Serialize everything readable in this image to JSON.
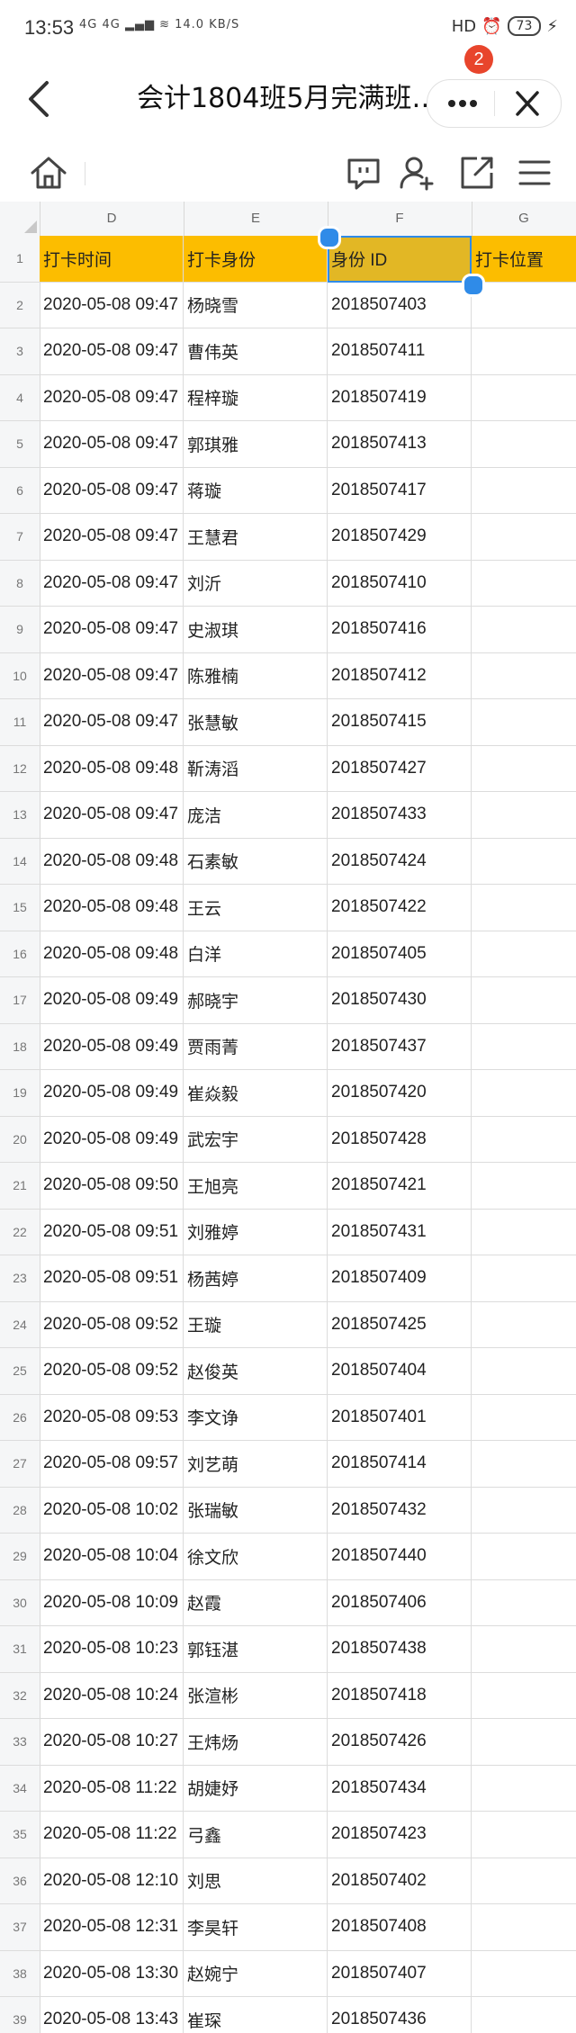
{
  "status_bar": {
    "time": "13:53",
    "left_icons": "4G 4G ▂▄▆ ≋ 14.0 KB/S",
    "hd": "HD",
    "battery": "73"
  },
  "title_bar": {
    "title": "会计1804班5月完满班…",
    "badge_count": "2"
  },
  "sheet": {
    "corner": "",
    "columns": [
      "D",
      "E",
      "F",
      "G"
    ],
    "header_row": {
      "num": "1",
      "d": "打卡时间",
      "e": "打卡身份",
      "f": "身份 ID",
      "g": "打卡位置"
    },
    "rows": [
      {
        "num": "2",
        "time": "2020-05-08 09:47",
        "name": "杨晓雪",
        "id": "2018507403"
      },
      {
        "num": "3",
        "time": "2020-05-08 09:47",
        "name": "曹伟英",
        "id": "2018507411"
      },
      {
        "num": "4",
        "time": "2020-05-08 09:47",
        "name": "程梓璇",
        "id": "2018507419"
      },
      {
        "num": "5",
        "time": "2020-05-08 09:47",
        "name": "郭琪雅",
        "id": "2018507413"
      },
      {
        "num": "6",
        "time": "2020-05-08 09:47",
        "name": "蒋璇",
        "id": "2018507417"
      },
      {
        "num": "7",
        "time": "2020-05-08 09:47",
        "name": "王慧君",
        "id": "2018507429"
      },
      {
        "num": "8",
        "time": "2020-05-08 09:47",
        "name": "刘沂",
        "id": "2018507410"
      },
      {
        "num": "9",
        "time": "2020-05-08 09:47",
        "name": "史淑琪",
        "id": "2018507416"
      },
      {
        "num": "10",
        "time": "2020-05-08 09:47",
        "name": "陈雅楠",
        "id": "2018507412"
      },
      {
        "num": "11",
        "time": "2020-05-08 09:47",
        "name": "张慧敏",
        "id": "2018507415"
      },
      {
        "num": "12",
        "time": "2020-05-08 09:48",
        "name": "靳涛滔",
        "id": "2018507427"
      },
      {
        "num": "13",
        "time": "2020-05-08 09:47",
        "name": "庞洁",
        "id": "2018507433"
      },
      {
        "num": "14",
        "time": "2020-05-08 09:48",
        "name": "石素敏",
        "id": "2018507424"
      },
      {
        "num": "15",
        "time": "2020-05-08 09:48",
        "name": "王云",
        "id": "2018507422"
      },
      {
        "num": "16",
        "time": "2020-05-08 09:48",
        "name": "白洋",
        "id": "2018507405"
      },
      {
        "num": "17",
        "time": "2020-05-08 09:49",
        "name": "郝晓宇",
        "id": "2018507430"
      },
      {
        "num": "18",
        "time": "2020-05-08 09:49",
        "name": "贾雨菁",
        "id": "2018507437"
      },
      {
        "num": "19",
        "time": "2020-05-08 09:49",
        "name": "崔焱毅",
        "id": "2018507420"
      },
      {
        "num": "20",
        "time": "2020-05-08 09:49",
        "name": "武宏宇",
        "id": "2018507428"
      },
      {
        "num": "21",
        "time": "2020-05-08 09:50",
        "name": "王旭亮",
        "id": "2018507421"
      },
      {
        "num": "22",
        "time": "2020-05-08 09:51",
        "name": "刘雅婷",
        "id": "2018507431"
      },
      {
        "num": "23",
        "time": "2020-05-08 09:51",
        "name": "杨茜婷",
        "id": "2018507409"
      },
      {
        "num": "24",
        "time": "2020-05-08 09:52",
        "name": "王璇",
        "id": "2018507425"
      },
      {
        "num": "25",
        "time": "2020-05-08 09:52",
        "name": "赵俊英",
        "id": "2018507404"
      },
      {
        "num": "26",
        "time": "2020-05-08 09:53",
        "name": "李文诤",
        "id": "2018507401"
      },
      {
        "num": "27",
        "time": "2020-05-08 09:57",
        "name": "刘艺萌",
        "id": "2018507414"
      },
      {
        "num": "28",
        "time": "2020-05-08 10:02",
        "name": "张瑞敏",
        "id": "2018507432"
      },
      {
        "num": "29",
        "time": "2020-05-08 10:04",
        "name": "徐文欣",
        "id": "2018507440"
      },
      {
        "num": "30",
        "time": "2020-05-08 10:09",
        "name": "赵霞",
        "id": "2018507406"
      },
      {
        "num": "31",
        "time": "2020-05-08 10:23",
        "name": "郭钰湛",
        "id": "2018507438"
      },
      {
        "num": "32",
        "time": "2020-05-08 10:24",
        "name": "张渲彬",
        "id": "2018507418"
      },
      {
        "num": "33",
        "time": "2020-05-08 10:27",
        "name": "王炜炀",
        "id": "2018507426"
      },
      {
        "num": "34",
        "time": "2020-05-08 11:22",
        "name": "胡婕妤",
        "id": "2018507434"
      },
      {
        "num": "35",
        "time": "2020-05-08 11:22",
        "name": "弓鑫",
        "id": "2018507423"
      },
      {
        "num": "36",
        "time": "2020-05-08 12:10",
        "name": "刘思",
        "id": "2018507402"
      },
      {
        "num": "37",
        "time": "2020-05-08 12:31",
        "name": "李昊轩",
        "id": "2018507408"
      },
      {
        "num": "38",
        "time": "2020-05-08 13:30",
        "name": "赵婉宁",
        "id": "2018507407"
      },
      {
        "num": "39",
        "time": "2020-05-08 13:43",
        "name": "崔琛",
        "id": "2018507436"
      }
    ]
  },
  "colors": {
    "header_fill": "#fcbd00",
    "selected_header_fill": "#e2b725",
    "selection": "#2f8be8",
    "badge": "#e8452c"
  },
  "icons": {
    "back": "chevron-left-icon",
    "more": "more-dots-icon",
    "close": "close-icon",
    "home": "home-icon",
    "comment": "comment-icon",
    "add_user": "add-user-icon",
    "share": "share-icon",
    "menu": "menu-icon"
  }
}
